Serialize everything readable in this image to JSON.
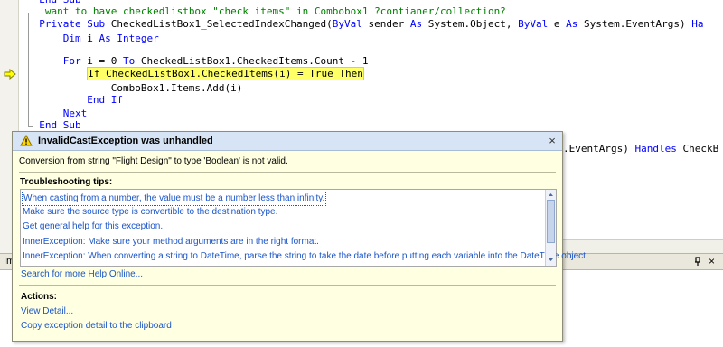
{
  "editor": {
    "lines": [
      {
        "indent": "  ",
        "parts": [
          {
            "t": "End Sub",
            "c": "kw"
          }
        ]
      },
      {
        "indent": "  ",
        "parts": [
          {
            "t": "'want to have checkedlistbox \"check items\" in Combobox1 ?contianer/collection?",
            "c": "cm"
          }
        ]
      },
      {
        "indent": "  ",
        "parts": [
          {
            "t": "Private Sub ",
            "c": "kw"
          },
          {
            "t": "CheckedListBox1_SelectedIndexChanged(",
            "c": ""
          },
          {
            "t": "ByVal",
            "c": "kw"
          },
          {
            "t": " sender ",
            "c": ""
          },
          {
            "t": "As",
            "c": "kw"
          },
          {
            "t": " System.Object, ",
            "c": ""
          },
          {
            "t": "ByVal",
            "c": "kw"
          },
          {
            "t": " e ",
            "c": ""
          },
          {
            "t": "As",
            "c": "kw"
          },
          {
            "t": " System.EventArgs) ",
            "c": ""
          },
          {
            "t": "Ha",
            "c": "kw"
          }
        ]
      },
      {
        "indent": "      ",
        "parts": [
          {
            "t": "Dim",
            "c": "kw"
          },
          {
            "t": " i ",
            "c": ""
          },
          {
            "t": "As",
            "c": "kw"
          },
          {
            "t": " ",
            "c": ""
          },
          {
            "t": "Integer",
            "c": "kw"
          }
        ]
      },
      {
        "indent": "",
        "parts": []
      },
      {
        "indent": "      ",
        "parts": [
          {
            "t": "For",
            "c": "kw"
          },
          {
            "t": " i = 0 ",
            "c": ""
          },
          {
            "t": "To",
            "c": "kw"
          },
          {
            "t": " CheckedListBox1.CheckedItems.Count - 1",
            "c": ""
          }
        ]
      },
      {
        "indent": "          ",
        "parts": [
          {
            "t": "If CheckedListBox1.CheckedItems(i) = True Then",
            "c": "hl"
          }
        ]
      },
      {
        "indent": "              ",
        "parts": [
          {
            "t": "ComboBox1.Items.Add(i)",
            "c": ""
          }
        ]
      },
      {
        "indent": "          ",
        "parts": [
          {
            "t": "End If",
            "c": "kw"
          }
        ]
      },
      {
        "indent": "      ",
        "parts": [
          {
            "t": "Next",
            "c": "kw"
          }
        ]
      },
      {
        "indent": "  ",
        "parts": [
          {
            "t": "End Sub",
            "c": "kw"
          }
        ]
      }
    ],
    "behind_line": [
      {
        "t": ".EventArgs) ",
        "c": ""
      },
      {
        "t": "Handles",
        "c": "kw"
      },
      {
        "t": " CheckB",
        "c": ""
      }
    ]
  },
  "lower_panel": {
    "title_stub": "Im",
    "close_glyph": "×"
  },
  "exception": {
    "title": "InvalidCastException was unhandled",
    "close_glyph": "×",
    "message": "Conversion from string \"Flight Design\" to type 'Boolean' is not valid.",
    "tips_header": "Troubleshooting tips:",
    "tips": [
      "When casting from a number, the value must be a number less than infinity.",
      "Make sure the source type is convertible to the destination type.",
      "Get general help for this exception.",
      "InnerException: Make sure your method arguments are in the right format.",
      "InnerException: When converting a string to DateTime, parse the string to take the date before putting each variable into the DateTime object."
    ],
    "search_link": "Search for more Help Online...",
    "actions_header": "Actions:",
    "actions": [
      "View Detail...",
      "Copy exception detail to the clipboard"
    ]
  },
  "colors": {
    "keyword": "#0000ff",
    "comment": "#008000",
    "highlight": "#ffff66",
    "link": "#1a55c7",
    "balloon": "#ffffe1"
  }
}
